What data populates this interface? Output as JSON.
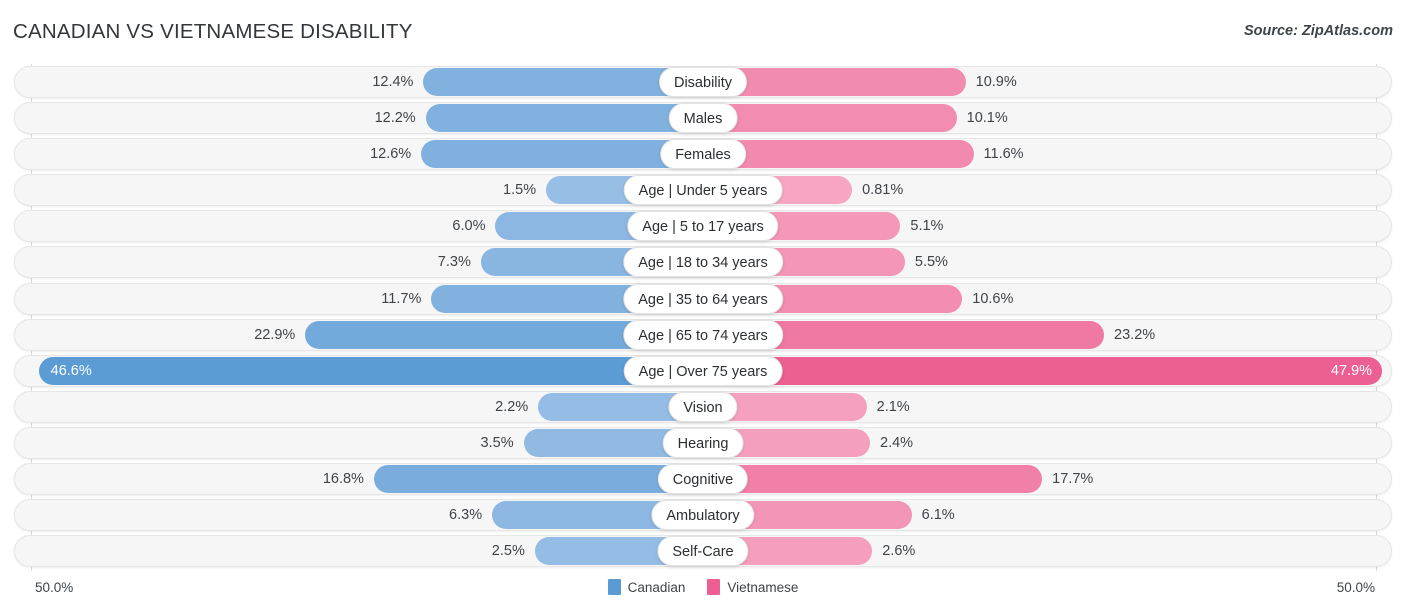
{
  "header": {
    "title": "CANADIAN VS VIETNAMESE DISABILITY",
    "source": "Source: ZipAtlas.com"
  },
  "axis": {
    "left_max_label": "50.0%",
    "right_max_label": "50.0%",
    "max": 50.0
  },
  "legend": {
    "items": [
      {
        "label": "Canadian",
        "color": "#5b9bd5"
      },
      {
        "label": "Vietnamese",
        "color": "#ed5e93"
      }
    ]
  },
  "colors": {
    "left_strong": "#5b9bd5",
    "left_light": "#a2c4e8",
    "right_strong": "#ec5f92",
    "right_light": "#f7aec8",
    "track": "#f6f6f6",
    "gridline": "#d6d8da"
  },
  "chart_data": {
    "type": "bar",
    "orientation": "horizontal-diverging",
    "title": "CANADIAN VS VIETNAMESE DISABILITY",
    "xlabel": "",
    "ylabel": "",
    "xlim": [
      0,
      50.0
    ],
    "grid": true,
    "legend_position": "bottom-center",
    "categories": [
      "Disability",
      "Males",
      "Females",
      "Age | Under 5 years",
      "Age | 5 to 17 years",
      "Age | 18 to 34 years",
      "Age | 35 to 64 years",
      "Age | 65 to 74 years",
      "Age | Over 75 years",
      "Vision",
      "Hearing",
      "Cognitive",
      "Ambulatory",
      "Self-Care"
    ],
    "series": [
      {
        "name": "Canadian",
        "color": "#5b9bd5",
        "values": [
          12.4,
          12.2,
          12.6,
          1.5,
          6.0,
          7.3,
          11.7,
          22.9,
          46.6,
          2.2,
          3.5,
          16.8,
          6.3,
          2.5
        ],
        "labels": [
          "12.4%",
          "12.2%",
          "12.6%",
          "1.5%",
          "6.0%",
          "7.3%",
          "11.7%",
          "22.9%",
          "46.6%",
          "2.2%",
          "3.5%",
          "16.8%",
          "6.3%",
          "2.5%"
        ]
      },
      {
        "name": "Vietnamese",
        "color": "#ec5f92",
        "values": [
          10.9,
          10.1,
          11.6,
          0.81,
          5.1,
          5.5,
          10.6,
          23.2,
          47.9,
          2.1,
          2.4,
          17.7,
          6.1,
          2.6
        ],
        "labels": [
          "10.9%",
          "10.1%",
          "11.6%",
          "0.81%",
          "5.1%",
          "5.5%",
          "10.6%",
          "23.2%",
          "47.9%",
          "2.1%",
          "2.4%",
          "17.7%",
          "6.1%",
          "2.6%"
        ]
      }
    ]
  }
}
